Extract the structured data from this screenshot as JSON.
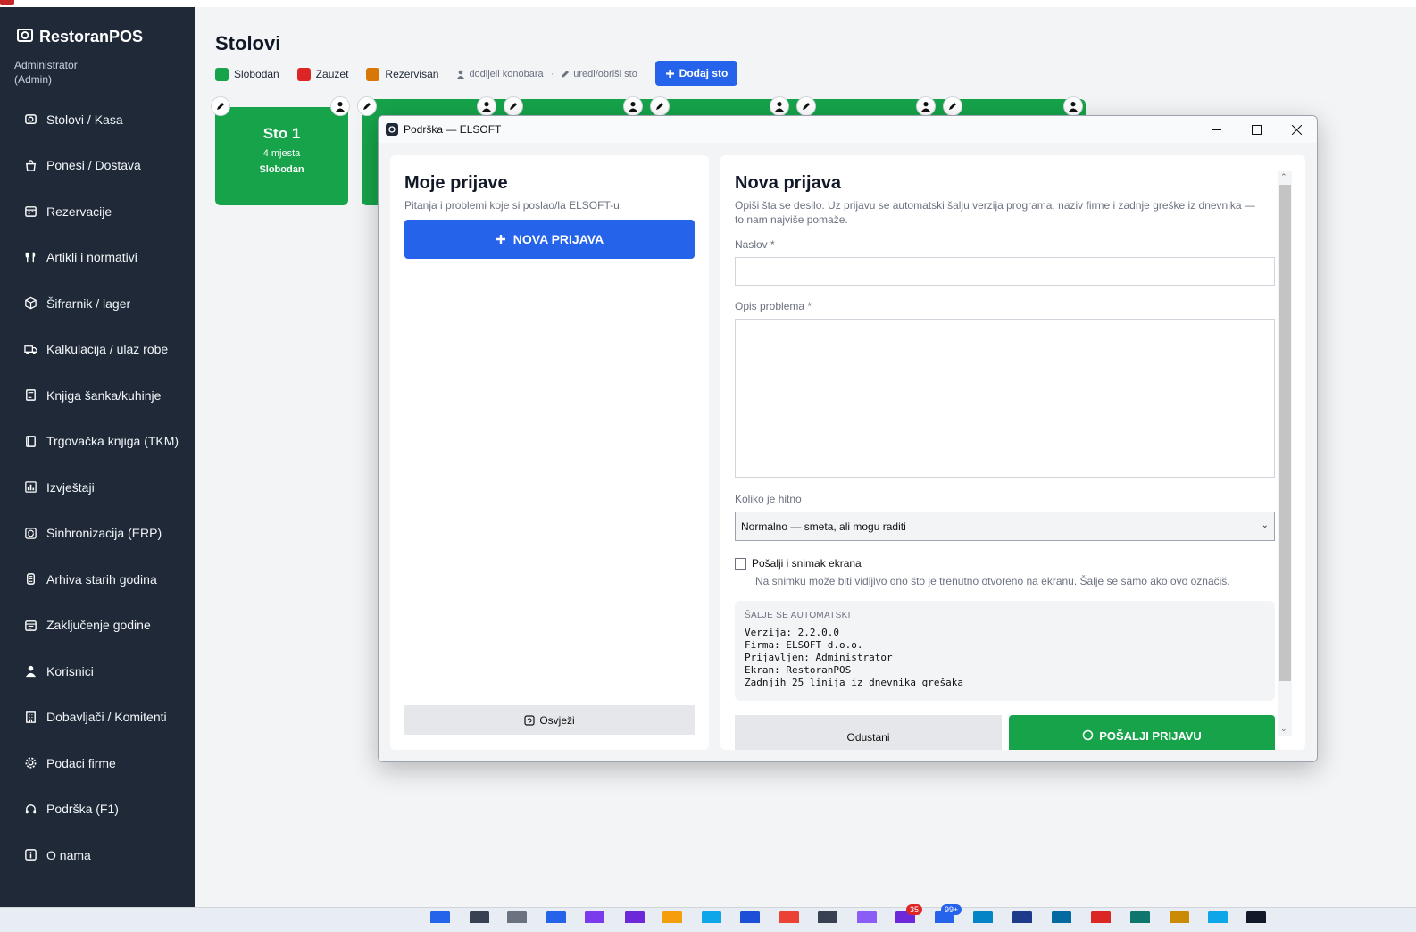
{
  "sidebar": {
    "brand": "RestoranPOS",
    "user": "Administrator (Admin)",
    "items": [
      {
        "label": "Stolovi / Kasa",
        "icon": "pos-icon"
      },
      {
        "label": "Ponesi / Dostava",
        "icon": "takeaway-icon"
      },
      {
        "label": "Rezervacije",
        "icon": "calendar-icon"
      },
      {
        "label": "Artikli i normativi",
        "icon": "utensils-icon"
      },
      {
        "label": "Šifrarnik / lager",
        "icon": "box-icon"
      },
      {
        "label": "Kalkulacija / ulaz robe",
        "icon": "truck-icon"
      },
      {
        "label": "Knjiga šanka/kuhinje",
        "icon": "book-icon"
      },
      {
        "label": "Trgovačka knjiga (TKM)",
        "icon": "ledger-icon"
      },
      {
        "label": "Izvještaji",
        "icon": "chart-icon"
      },
      {
        "label": "Sinhronizacija (ERP)",
        "icon": "sync-icon"
      },
      {
        "label": "Arhiva starih godina",
        "icon": "archive-icon"
      },
      {
        "label": "Zaključenje godine",
        "icon": "calendar-close-icon"
      },
      {
        "label": "Korisnici",
        "icon": "user-icon"
      },
      {
        "label": "Dobavljači / Komitenti",
        "icon": "building-icon"
      },
      {
        "label": "Podaci firme",
        "icon": "gear-icon"
      },
      {
        "label": "Podrška  (F1)",
        "icon": "headset-icon"
      },
      {
        "label": "O nama",
        "icon": "info-icon"
      }
    ]
  },
  "main": {
    "title": "Stolovi",
    "legend": [
      {
        "label": "Slobodan",
        "color": "#16a34a"
      },
      {
        "label": "Zauzet",
        "color": "#dc2626"
      },
      {
        "label": "Rezervisan",
        "color": "#d97706"
      }
    ],
    "hint_assign": "dodijeli konobara",
    "hint_sep": "·",
    "hint_edit": "uredi/obriši sto",
    "add_button": "Dodaj sto",
    "table": {
      "name": "Sto 1",
      "seats": "4 mjesta",
      "status": "Slobodan"
    }
  },
  "dialog": {
    "title": "Podrška — ELSOFT",
    "left": {
      "heading": "Moje prijave",
      "subtitle": "Pitanja i problemi koje si poslao/la ELSOFT-u.",
      "new_button": "NOVA PRIJAVA",
      "refresh_button": "Osvježi"
    },
    "right": {
      "heading": "Nova prijava",
      "description": "Opiši šta se desilo. Uz prijavu se automatski šalju verzija programa, naziv firme i zadnje greške iz dnevnika — to nam najviše pomaže.",
      "title_label": "Naslov *",
      "title_value": "",
      "desc_label": "Opis problema *",
      "desc_value": "",
      "urgency_label": "Koliko je hitno",
      "urgency_value": "Normalno — smeta, ali mogu raditi",
      "screenshot_label": "Pošalji i snimak ekrana",
      "screenshot_note": "Na snimku može biti vidljivo ono što je trenutno otvoreno na ekranu. Šalje se samo ako ovo označiš.",
      "auto_title": "ŠALJE SE AUTOMATSKI",
      "auto_lines": [
        "Verzija: 2.2.0.0",
        "Firma: ELSOFT d.o.o.",
        "Prijavljen: Administrator",
        "Ekran: RestoranPOS",
        "Zadnjih 25 linija iz dnevnika grešaka"
      ],
      "cancel_button": "Odustani",
      "send_button": "POŠALJI PRIJAVU"
    }
  },
  "taskbar": {
    "badge_calls": "35",
    "badge_mail": "99+"
  }
}
